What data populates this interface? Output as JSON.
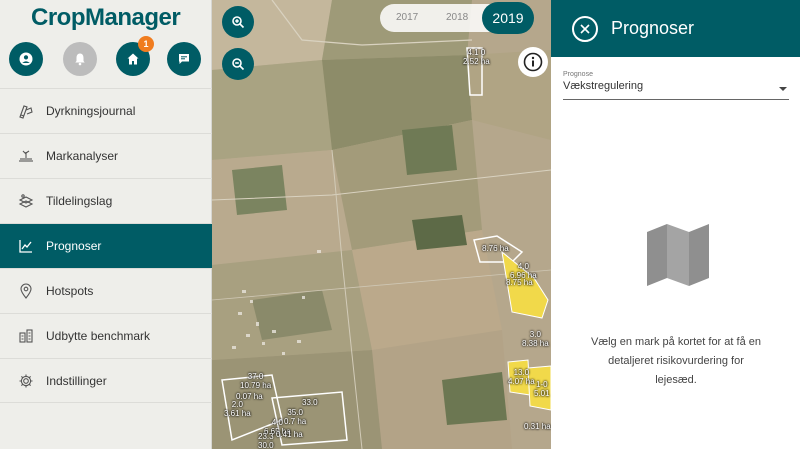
{
  "app": {
    "logo": "CropManager"
  },
  "top_icons": {
    "notification_count": "1"
  },
  "nav": {
    "items": [
      {
        "label": "Dyrkningsjournal",
        "icon": "journal-icon"
      },
      {
        "label": "Markanalyser",
        "icon": "soil-analysis-icon"
      },
      {
        "label": "Tildelingslag",
        "icon": "layers-icon"
      },
      {
        "label": "Prognoser",
        "icon": "chart-line-icon",
        "active": true
      },
      {
        "label": "Hotspots",
        "icon": "location-pin-icon"
      },
      {
        "label": "Udbytte benchmark",
        "icon": "benchmark-icon"
      },
      {
        "label": "Indstillinger",
        "icon": "gear-icon"
      }
    ]
  },
  "map": {
    "years": [
      "2017",
      "2018",
      "2019"
    ],
    "active_year": "2019",
    "field_labels": [
      {
        "l1": "4.1 0",
        "l2": "2.52 ha"
      },
      {
        "l1": "8.76 ha",
        "l2": ""
      },
      {
        "l1": "4.0",
        "l2": "6.96 ha"
      },
      {
        "l1": "",
        "l2": "8.75 ha"
      },
      {
        "l1": "3.0",
        "l2": "8.38 ha"
      },
      {
        "l1": "13.0",
        "l2": "4.07 ha"
      },
      {
        "l1": "1-0",
        "l2": "5.01"
      },
      {
        "l1": "37.0",
        "l2": "10.79 ha"
      },
      {
        "l1": "",
        "l2": "0.07 ha"
      },
      {
        "l1": "2.0",
        "l2": "3.61 ha"
      },
      {
        "l1": "33.0",
        "l2": ""
      },
      {
        "l1": "35.0",
        "l2": "0.7 ha"
      },
      {
        "l1": "4.0",
        "l2": "6.65 ha"
      },
      {
        "l1": "",
        "l2": "0.41 ha"
      },
      {
        "l1": "23.3",
        "l2": "30.0"
      },
      {
        "l1": "",
        "l2": "0.31 ha"
      }
    ]
  },
  "panel": {
    "title": "Prognoser",
    "select_label": "Prognose",
    "select_value": "Vækstregulering",
    "message": "Vælg en mark på kortet for at få en detaljeret risikovurdering for lejesæd."
  },
  "colors": {
    "brand": "#005c65",
    "badge": "#f07c1f",
    "field_yellow": "#f1d94a"
  }
}
